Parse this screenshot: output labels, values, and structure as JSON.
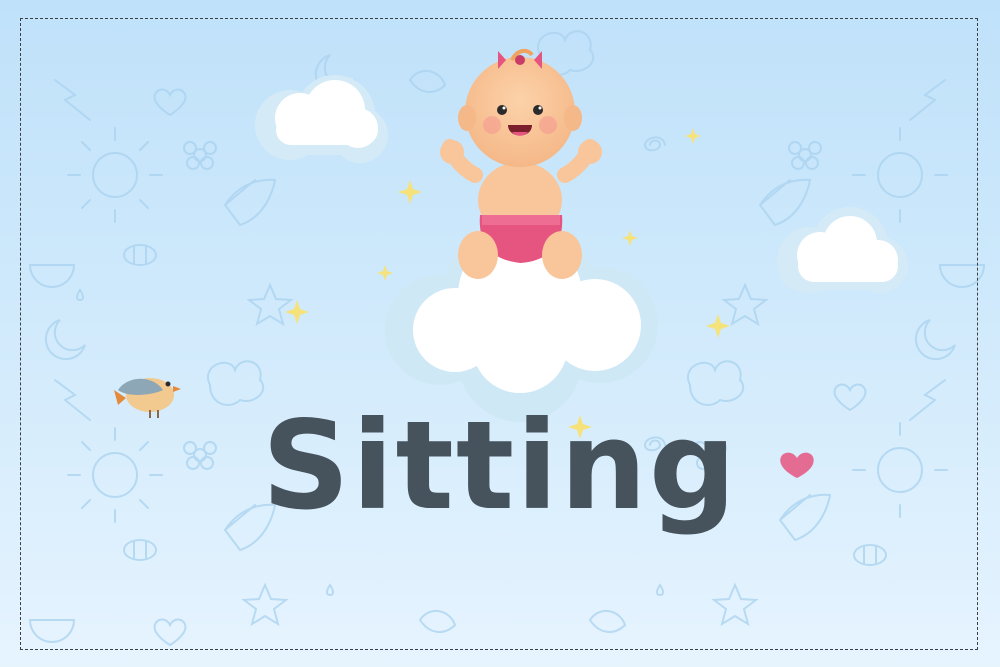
{
  "card": {
    "title": "Sitting",
    "title_color": "#46535d",
    "background_colors": [
      "#bfe1fa",
      "#e6f4fe"
    ]
  },
  "illustration": {
    "main": "baby-on-cloud",
    "decorations": [
      "cloud-left",
      "cloud-right",
      "bird-icon",
      "heart-icon",
      "sparkle-icon"
    ]
  }
}
